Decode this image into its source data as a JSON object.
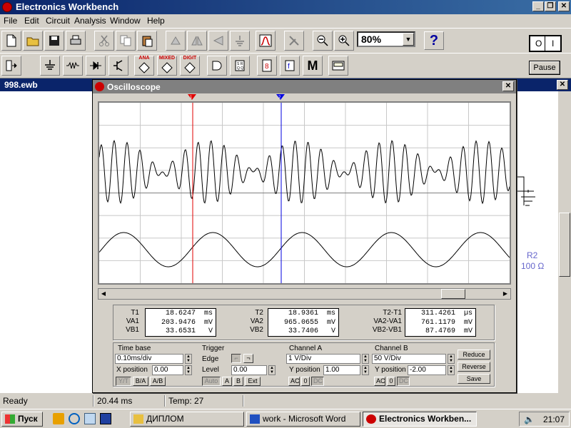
{
  "app": {
    "title": "Electronics Workbench",
    "controls": {
      "minimize": "_",
      "maximize": "❐",
      "close": "✕"
    }
  },
  "menu": [
    "File",
    "Edit",
    "Circuit",
    "Analysis",
    "Window",
    "Help"
  ],
  "toolbar": {
    "zoom": "80%",
    "help": "?",
    "power_off": "O",
    "power_on": "I",
    "pause": "Pause",
    "parts_labels": {
      "ana": "ANA",
      "mixed": "MIXED",
      "digit": "DIGIT",
      "m": "M"
    }
  },
  "document": {
    "title": "998.ewb",
    "close": "✕",
    "r2_name": "R2",
    "r2_value": "100 Ω"
  },
  "oscilloscope": {
    "title": "Oscilloscope",
    "close": "✕",
    "cursor1_label": "1",
    "cursor2_label": "2",
    "cursor1_color": "#e00000",
    "cursor2_color": "#0000e0",
    "readouts": {
      "t1": {
        "label": "T1",
        "value": "18.6247",
        "unit": "ms"
      },
      "va1": {
        "label": "VA1",
        "value": "203.9476",
        "unit": "mV"
      },
      "vb1": {
        "label": "VB1",
        "value": "33.6531",
        "unit": "V"
      },
      "t2": {
        "label": "T2",
        "value": "18.9361",
        "unit": "ms"
      },
      "va2": {
        "label": "VA2",
        "value": "965.0655",
        "unit": "mV"
      },
      "vb2": {
        "label": "VB2",
        "value": "33.7406",
        "unit": "V"
      },
      "dt": {
        "label": "T2-T1",
        "value": "311.4261",
        "unit": "µs"
      },
      "dva": {
        "label": "VA2-VA1",
        "value": "761.1179",
        "unit": "mV"
      },
      "dvb": {
        "label": "VB2-VB1",
        "value": "87.4769",
        "unit": "mV"
      }
    },
    "timebase": {
      "group": "Time base",
      "scale": "0.10ms/div",
      "xpos_label": "X position",
      "xpos": "0.00",
      "modes": [
        "Y/T",
        "B/A",
        "A/B"
      ]
    },
    "trigger": {
      "group": "Trigger",
      "edge_label": "Edge",
      "level_label": "Level",
      "level": "0.00",
      "sources": [
        "Auto",
        "A",
        "B",
        "Ext"
      ]
    },
    "channel_a": {
      "group": "Channel A",
      "scale": "1 V/Div",
      "ypos_label": "Y position",
      "ypos": "1.00",
      "coupling": [
        "AC",
        "0",
        "DC"
      ]
    },
    "channel_b": {
      "group": "Channel B",
      "scale": "50 V/Div",
      "ypos_label": "Y position",
      "ypos": "-2.00",
      "coupling": [
        "AC",
        "0",
        "DC"
      ]
    },
    "buttons": {
      "reduce": "Reduce",
      "reverse": "Reverse",
      "save": "Save"
    }
  },
  "statusbar": {
    "ready": "Ready",
    "time": "20.44 ms",
    "temp": "Temp:  27"
  },
  "taskbar": {
    "start": "Пуск",
    "tasks": [
      "ДИПЛОМ",
      "work - Microsoft Word",
      "Electronics Workben..."
    ],
    "clock": "21:07",
    "tray_icon": "speaker-icon"
  }
}
